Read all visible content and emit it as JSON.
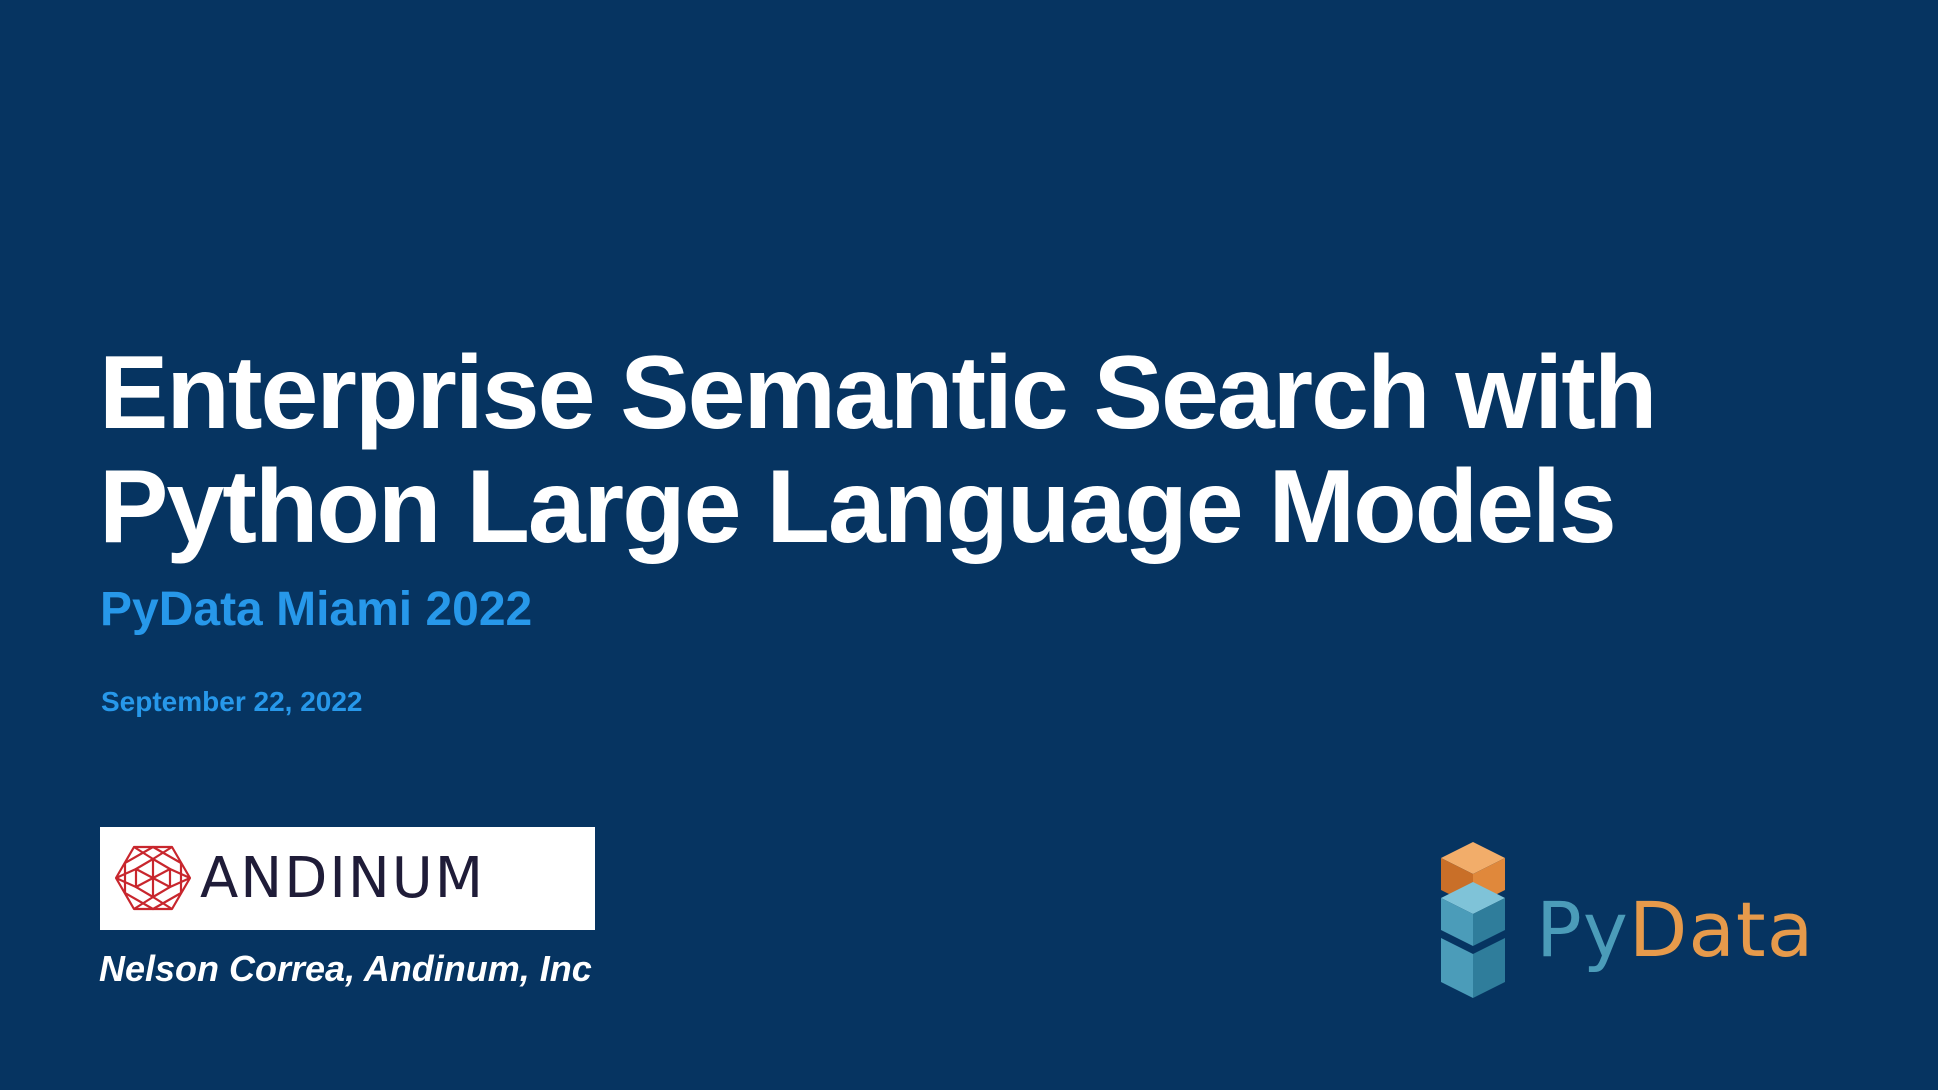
{
  "slide": {
    "title_line1": "Enterprise Semantic Search with",
    "title_line2": "Python Large Language Models",
    "subtitle": "PyData Miami 2022",
    "date": "September 22, 2022",
    "author": "Nelson Correa, Andinum, Inc"
  },
  "logos": {
    "andinum": {
      "wordmark": "ANDINUM",
      "icon": "red-polyhedron-icon"
    },
    "pydata": {
      "wordmark_py": "Py",
      "wordmark_data": "Data",
      "icon": "stacked-cubes-icon"
    }
  },
  "colors": {
    "background": "#063461",
    "title": "#ffffff",
    "accent": "#2798ea",
    "andinum_red": "#c8262d",
    "andinum_text": "#1f1c38",
    "pydata_blue": "#4b9cb9",
    "pydata_orange": "#e69a4b"
  }
}
